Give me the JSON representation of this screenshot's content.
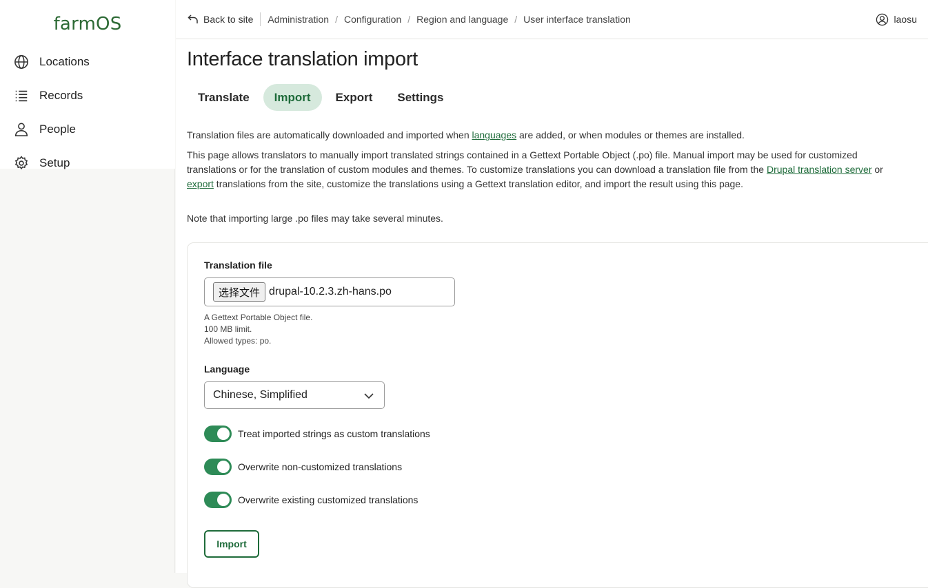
{
  "app": {
    "logo": "farmOS"
  },
  "sidebar": {
    "items": [
      {
        "label": "Locations",
        "icon": "globe-icon"
      },
      {
        "label": "Records",
        "icon": "list-icon"
      },
      {
        "label": "People",
        "icon": "person-icon"
      },
      {
        "label": "Setup",
        "icon": "gear-icon"
      }
    ]
  },
  "topbar": {
    "back": "Back to site",
    "breadcrumbs": [
      "Administration",
      "Configuration",
      "Region and language",
      "User interface translation"
    ],
    "user": "laosu"
  },
  "page": {
    "title": "Interface translation import",
    "tabs": [
      "Translate",
      "Import",
      "Export",
      "Settings"
    ],
    "active_tab": "Import"
  },
  "intro": {
    "p1_before": "Translation files are automatically downloaded and imported when ",
    "p1_link": "languages",
    "p1_after": " are added, or when modules or themes are installed.",
    "p2_before": "This page allows translators to manually import translated strings contained in a Gettext Portable Object (.po) file. Manual import may be used for customized translations or for the translation of custom modules and themes. To customize translations you can download a translation file from the ",
    "p2_link1": "Drupal translation server",
    "p2_mid": " or ",
    "p2_link2": "export",
    "p2_after": " translations from the site, customize the translations using a Gettext translation editor, and import the result using this page.",
    "p3": "Note that importing large .po files may take several minutes."
  },
  "form": {
    "file_label": "Translation file",
    "file_button": "选择文件",
    "file_name": "drupal-10.2.3.zh-hans.po",
    "file_help": [
      "A Gettext Portable Object file.",
      "100 MB limit.",
      "Allowed types: po."
    ],
    "language_label": "Language",
    "language_value": "Chinese, Simplified",
    "toggles": [
      {
        "label": "Treat imported strings as custom translations",
        "on": true
      },
      {
        "label": "Overwrite non-customized translations",
        "on": true
      },
      {
        "label": "Overwrite existing customized translations",
        "on": true
      }
    ],
    "submit": "Import"
  },
  "colors": {
    "accent": "#1e6b3a",
    "toggle_on": "#2e8b57",
    "tab_active_bg": "#d6e9dd"
  }
}
